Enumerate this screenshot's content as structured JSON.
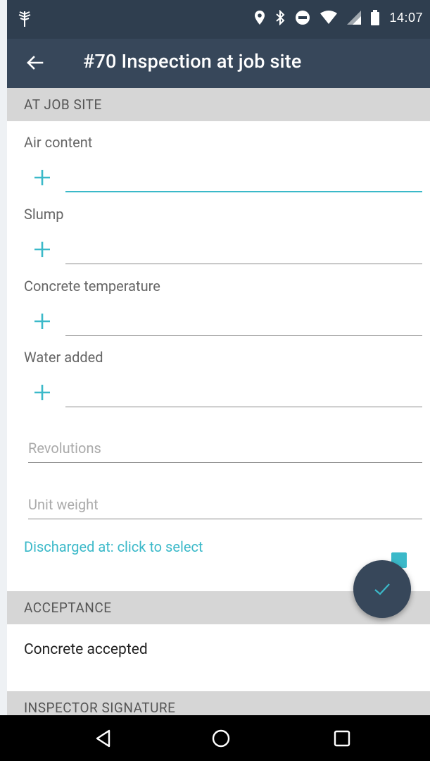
{
  "status_bar": {
    "time": "14:07",
    "icons": [
      "tree-notification-icon",
      "location-icon",
      "bluetooth-icon",
      "do-not-disturb-icon",
      "wifi-icon",
      "signal-icon",
      "battery-icon"
    ]
  },
  "app_bar": {
    "title": "#70 Inspection at job site",
    "back_icon": "arrow-back-icon"
  },
  "sections": {
    "at_job_site": "AT JOB SITE",
    "acceptance": "ACCEPTANCE",
    "inspector_signature": "INSPECTOR SIGNATURE"
  },
  "fields": {
    "air_content": {
      "label": "Air content",
      "value": ""
    },
    "slump": {
      "label": "Slump",
      "value": ""
    },
    "concrete_temperature": {
      "label": "Concrete temperature",
      "value": ""
    },
    "water_added": {
      "label": "Water added",
      "value": ""
    },
    "revolutions": {
      "placeholder": "Revolutions",
      "value": ""
    },
    "unit_weight": {
      "placeholder": "Unit weight",
      "value": ""
    }
  },
  "discharged_link": "Discharged at: click to select",
  "acceptance": {
    "label": "Concrete accepted",
    "checked": true
  },
  "fab_icon": "check-icon",
  "colors": {
    "accent": "#3bb9c9",
    "status_bar": "#2f3e4f",
    "app_bar": "#37475a",
    "section_bg": "#d6d6d6"
  },
  "nav_bar": {
    "icons": [
      "back-triangle-icon",
      "home-circle-icon",
      "recents-square-icon"
    ]
  }
}
